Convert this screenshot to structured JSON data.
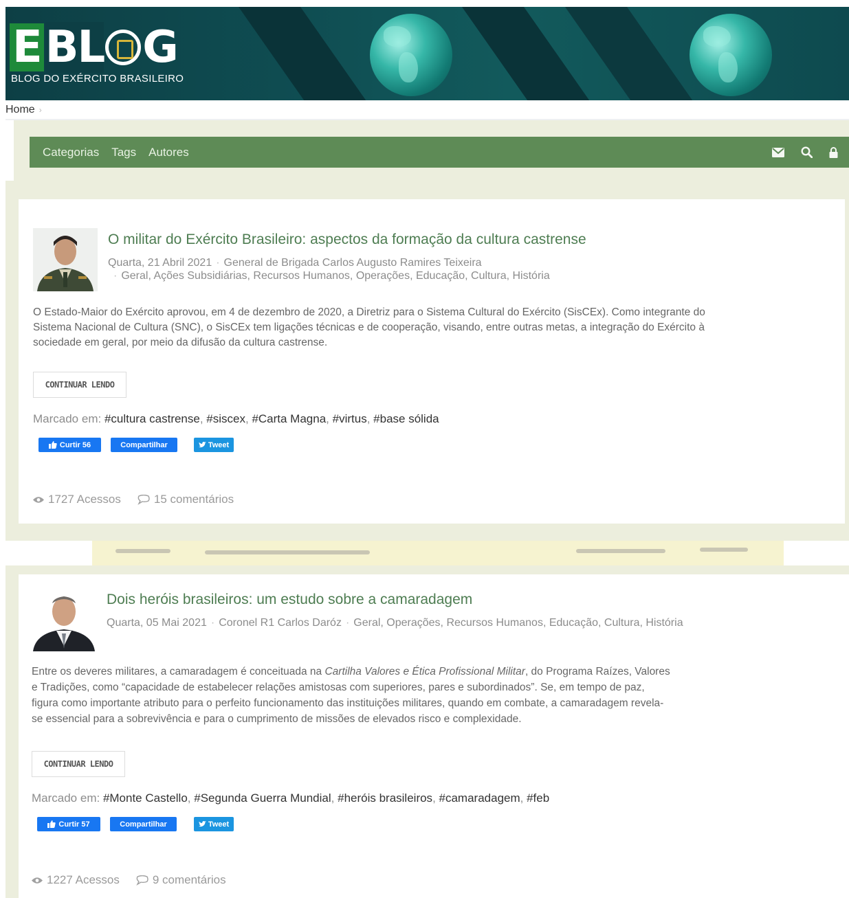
{
  "header": {
    "logo_text": "EBLOG",
    "subtitle": "BLOG DO EXÉRCITO BRASILEIRO"
  },
  "breadcrumb": {
    "home": "Home",
    "separator": "›"
  },
  "nav": {
    "links": [
      "Categorias",
      "Tags",
      "Autores"
    ],
    "icons": [
      "envelope-icon",
      "search-icon",
      "lock-icon"
    ]
  },
  "posts": [
    {
      "title": "O militar do Exército Brasileiro: aspectos da formação da cultura castrense",
      "date": "Quarta, 21 Abril 2021",
      "author": "General de Brigada Carlos Augusto Ramires Teixeira",
      "categories": "Geral, Ações Subsidiárias, Recursos Humanos, Operações, Educação, Cultura, História",
      "excerpt_lines": [
        "O Estado-Maior do Exército aprovou, em 4 de dezembro de 2020, a Diretriz para o Sistema Cultural do Exército (SisCEx). Como integrante do",
        "Sistema Nacional de Cultura (SNC), o SisCEx tem ligações técnicas e de cooperação, visando, entre outras metas, a integração do Exército à",
        "sociedade em geral, por meio da difusão da cultura castrense."
      ],
      "continue_label": "CONTINUAR LENDO",
      "tagged_label": "Marcado em:",
      "tags": [
        "#cultura castrense",
        "#siscex",
        "#Carta Magna",
        "#virtus",
        "#base sólida"
      ],
      "like_label": "Curtir 56",
      "share_label": "Compartilhar",
      "tweet_label": "Tweet",
      "views": "1727 Acessos",
      "comments": "15 comentários"
    },
    {
      "title": "Dois heróis brasileiros: um estudo sobre a camaradagem",
      "date": "Quarta, 05 Mai 2021",
      "author": "Coronel R1 Carlos Daróz",
      "categories": "Geral, Operações, Recursos Humanos, Educação, Cultura, História",
      "excerpt_lines": [
        "Entre os deveres militares, a camaradagem é conceituada na ",
        "Cartilha Valores e Ética Profissional Militar",
        ", do Programa Raízes, Valores",
        "e Tradições, como “capacidade de estabelecer relações amistosas com superiores, pares e subordinados”. Se, em tempo de paz,",
        "figura como importante atributo para o perfeito funcionamento das instituições militares, quando em combate, a camaradagem revela-",
        "se essencial para a sobrevivência e para o cumprimento de missões de elevados risco e complexidade."
      ],
      "continue_label": "CONTINUAR LENDO",
      "tagged_label": "Marcado em:",
      "tags": [
        "#Monte Castello",
        "#Segunda Guerra Mundial",
        "#heróis brasileiros",
        "#camaradagem",
        "#feb"
      ],
      "like_label": "Curtir 57",
      "share_label": "Compartilhar",
      "tweet_label": "Tweet",
      "views": "1227 Acessos",
      "comments": "9 comentários"
    }
  ],
  "colors": {
    "nav_green": "#5e8b56",
    "title_green": "#4e7d52",
    "cream": "#eceedd",
    "banner_teal": "#0f4d52",
    "facebook_blue": "#1877f2",
    "twitter_blue": "#1b95e0"
  }
}
